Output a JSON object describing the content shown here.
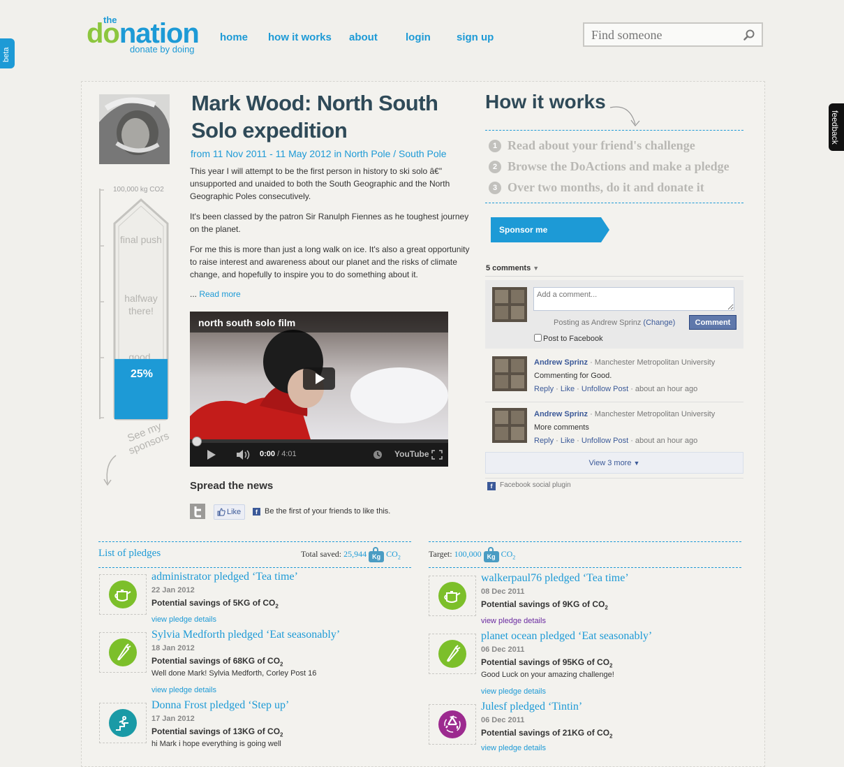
{
  "side_tabs": {
    "beta": "beta",
    "feedback": "feedback"
  },
  "logo": {
    "the": "the",
    "main_do": "do",
    "main_nation": "nation",
    "tagline": "donate by doing"
  },
  "nav": [
    {
      "label": "home"
    },
    {
      "label": "how it works"
    },
    {
      "label": "about"
    },
    {
      "label": "login"
    },
    {
      "label": "sign up"
    }
  ],
  "search": {
    "placeholder": "Find someone"
  },
  "challenge": {
    "title": "Mark Wood: North South Solo expedition",
    "dates": "from 11 Nov 2011 - 11 May 2012 in North Pole / South Pole",
    "paragraphs": [
      "This year I will attempt to be the first person in history to ski solo â€\" unsupported and unaided to both the South Geographic and the North Geographic Poles consecutively.",
      "It's been classed by the patron Sir Ranulph Fiennes as he toughest journey on the planet.",
      "For me this is more than just a long walk on ice. It's also a great opportunity to raise interest and awareness about our planet and the risks of climate change, and hopefully to inspire you to do something about it."
    ],
    "ellipsis": "... ",
    "read_more": "Read more"
  },
  "thermometer": {
    "target_label": "100,000 kg CO2",
    "final_push": "final push",
    "halfway": "halfway there!",
    "good": "good",
    "percent_label": "25%",
    "progress": 0.25,
    "see_sponsors": "See my sponsors"
  },
  "video": {
    "title": "north south solo film",
    "time_current": "0:00",
    "time_total": " / 4:01",
    "brand": "YouTube"
  },
  "spread": {
    "heading": "Spread the news",
    "like_label": "Like",
    "like_text": "Be the first of your friends to like this."
  },
  "how_it_works": {
    "title": "How it works",
    "steps": [
      {
        "num": "1",
        "text": "Read about your friend's challenge"
      },
      {
        "num": "2",
        "text": "Browse the DoActions and make a pledge"
      },
      {
        "num": "3",
        "text": "Over two months, do it and donate it"
      }
    ],
    "sponsor_button": "Sponsor me"
  },
  "comments": {
    "count_label": "5 comments",
    "input_placeholder": "Add a comment...",
    "posting_as": "Posting as Andrew Sprinz",
    "change": "(Change)",
    "comment_button": "Comment",
    "post_to_facebook": "Post to Facebook",
    "items": [
      {
        "author": "Andrew Sprinz",
        "org": " · Manchester Metropolitan University",
        "text": "Commenting for Good.",
        "reply": "Reply",
        "like": "Like",
        "unfollow": "Unfollow Post",
        "ago": "about an hour ago"
      },
      {
        "author": "Andrew Sprinz",
        "org": " · Manchester Metropolitan University",
        "text": "More comments",
        "reply": "Reply",
        "like": "Like",
        "unfollow": "Unfollow Post",
        "ago": "about an hour ago"
      }
    ],
    "view_more": "View 3 more",
    "plugin_label": "Facebook social plugin"
  },
  "pledges": {
    "list_title": "List of pledges",
    "total_saved_label": "Total saved:",
    "total_saved_value": "25,944",
    "target_label": "Target:",
    "target_value": "100,000",
    "kg": "Kg",
    "co": "CO",
    "two": "2",
    "left": [
      {
        "title": "administrator pledged ‘Tea time’",
        "date": "22 Jan 2012",
        "savings": "Potential savings of 5KG of CO",
        "note": "",
        "link": "view pledge details",
        "icon": "teapot-icon",
        "color": "#7cbf2a"
      },
      {
        "title": "Sylvia Medforth pledged ‘Eat seasonably’",
        "date": "18 Jan 2012",
        "savings": "Potential savings of 68KG of CO",
        "note": "Well done Mark! Sylvia Medforth, Corley Post 16",
        "link": "view pledge details",
        "icon": "carrot-icon",
        "color": "#7cbf2a"
      },
      {
        "title": "Donna Frost pledged ‘Step up’",
        "date": "17 Jan 2012",
        "savings": "Potential savings of 13KG of CO",
        "note": "hi Mark i hope everything is going well",
        "link": "",
        "icon": "stairs-icon",
        "color": "#1a9aa6"
      }
    ],
    "right": [
      {
        "title": "walkerpaul76 pledged ‘Tea time’",
        "date": "08 Dec 2011",
        "savings": "Potential savings of 9KG of CO",
        "note": "",
        "link": "view pledge details",
        "icon": "teapot-icon",
        "color": "#7cbf2a"
      },
      {
        "title": "planet ocean pledged ‘Eat seasonably’",
        "date": "06 Dec 2011",
        "savings": "Potential savings of 95KG of CO",
        "note": "Good Luck on your amazing challenge!",
        "link": "view pledge details",
        "icon": "carrot-icon",
        "color": "#7cbf2a"
      },
      {
        "title": "Julesf pledged ‘Tintin’",
        "date": "06 Dec 2011",
        "savings": "Potential savings of 21KG of CO",
        "note": "",
        "link": "view pledge details",
        "icon": "recycle-icon",
        "color": "#9c2a8f"
      }
    ]
  }
}
